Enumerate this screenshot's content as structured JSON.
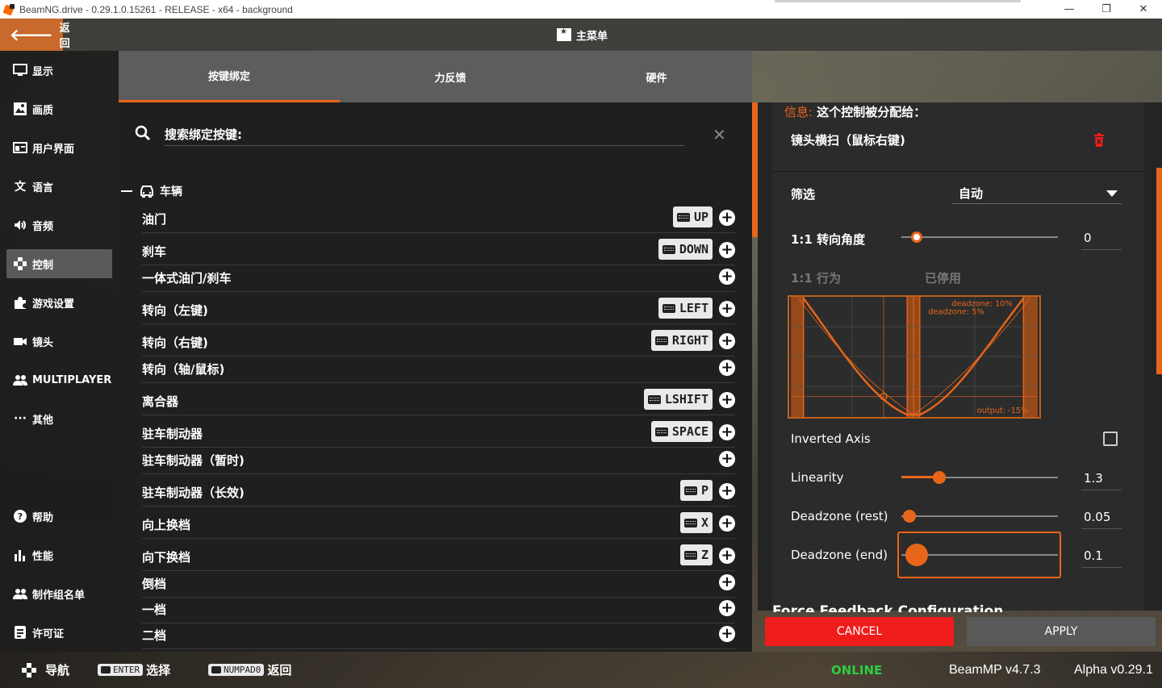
{
  "window": {
    "title": "BeamNG.drive - 0.29.1.0.15261 - RELEASE - x64 - background",
    "minimize": "—",
    "maximize": "❐",
    "close": "✕"
  },
  "header": {
    "back_label": "返回",
    "title": "主菜单"
  },
  "sidebar": {
    "items": [
      {
        "label": "显示",
        "icon": "monitor-icon"
      },
      {
        "label": "画质",
        "icon": "image-icon"
      },
      {
        "label": "用户界面",
        "icon": "ui-icon"
      },
      {
        "label": "语言",
        "icon": "translate-icon"
      },
      {
        "label": "音频",
        "icon": "speaker-icon"
      },
      {
        "label": "控制",
        "icon": "gamepad-icon",
        "active": true
      },
      {
        "label": "游戏设置",
        "icon": "puzzle-icon"
      },
      {
        "label": "镜头",
        "icon": "camera-icon"
      },
      {
        "label": "MULTIPLAYER",
        "icon": "users-icon"
      },
      {
        "label": "其他",
        "icon": "more-icon"
      },
      {
        "label": "帮助",
        "icon": "help-icon"
      },
      {
        "label": "性能",
        "icon": "bar-chart-icon"
      },
      {
        "label": "制作组名单",
        "icon": "group-icon"
      },
      {
        "label": "许可证",
        "icon": "license-icon"
      }
    ]
  },
  "tabs": [
    {
      "label": "按键绑定",
      "active": true
    },
    {
      "label": "力反馈"
    },
    {
      "label": "硬件"
    }
  ],
  "search": {
    "placeholder": "搜索绑定按键:",
    "clear": "✕"
  },
  "group": {
    "label": "车辆"
  },
  "bindings": [
    {
      "label": "油门",
      "key": "UP"
    },
    {
      "label": "刹车",
      "key": "DOWN"
    },
    {
      "label": "一体式油门/刹车",
      "key": null
    },
    {
      "label": "转向（左键)",
      "key": "LEFT"
    },
    {
      "label": "转向（右键)",
      "key": "RIGHT"
    },
    {
      "label": "转向（轴/鼠标)",
      "key": null
    },
    {
      "label": "离合器",
      "key": "LSHIFT"
    },
    {
      "label": "驻车制动器",
      "key": "SPACE"
    },
    {
      "label": "驻车制动器（暂时)",
      "key": null
    },
    {
      "label": "驻车制动器（长效)",
      "key": "P"
    },
    {
      "label": "向上换档",
      "key": "X"
    },
    {
      "label": "向下换档",
      "key": "Z"
    },
    {
      "label": "倒档",
      "key": null
    },
    {
      "label": "一档",
      "key": null
    },
    {
      "label": "二档",
      "key": null
    }
  ],
  "detail": {
    "info_prefix": "信息:",
    "info_text": " 这个控制被分配给：",
    "assigned_to": "镜头横扫（鼠标右键)",
    "filter_label": "筛选",
    "filter_value": "自动",
    "steer_angle_label": "1:1 转向角度",
    "steer_angle_value": "0",
    "steer_angle_level": 0.1,
    "behavior_label": "1:1 行为",
    "behavior_value": "已停用",
    "graph": {
      "deadzone_end_label": "deadzone: 10%",
      "deadzone_rest_label": "deadzone: 5%",
      "output_label": "output: -15%"
    },
    "inverted_label": "Inverted Axis",
    "inverted_checked": false,
    "linearity_label": "Linearity",
    "linearity_value": "1.3",
    "linearity_level": 0.24,
    "deadzone_rest_label": "Deadzone (rest)",
    "deadzone_rest_value": "0.05",
    "deadzone_rest_level": 0.05,
    "deadzone_end_label": "Deadzone (end)",
    "deadzone_end_value": "0.1",
    "deadzone_end_level": 0.1,
    "ffb_heading": "Force Feedback Configuration",
    "cancel": "CANCEL",
    "apply": "APPLY"
  },
  "footer": {
    "nav_label": "导航",
    "enter_key": "ENTER",
    "select_label": "选择",
    "numpad_key": "NUMPAD0",
    "back_label": "返回",
    "status": "ONLINE",
    "beammp": "BeamMP v4.7.3",
    "alpha": "Alpha v0.29.1"
  },
  "colors": {
    "accent": "#e8661a",
    "cancel": "#ef1c1c",
    "online": "#2ecc40"
  }
}
